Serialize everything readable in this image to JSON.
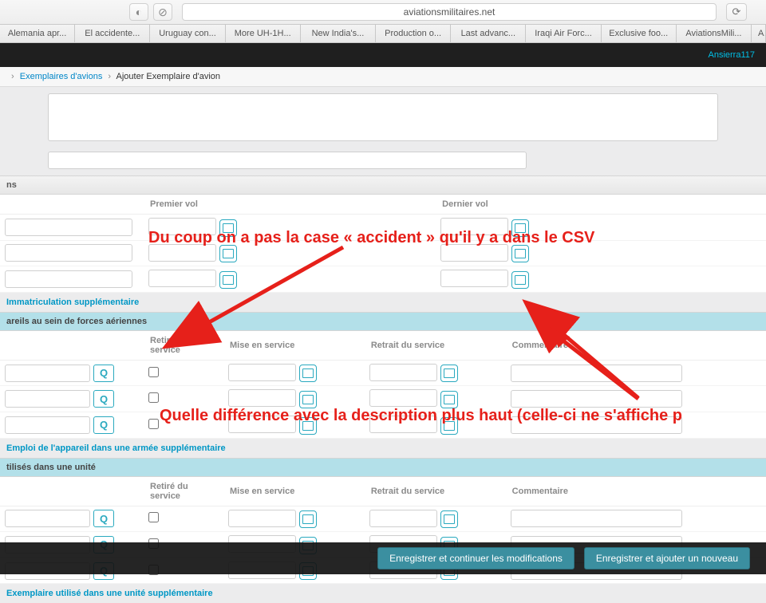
{
  "browser": {
    "address": "aviationsmilitaires.net",
    "tabs": [
      "Alemania apr...",
      "El accidente...",
      "Uruguay con...",
      "More UH-1H...",
      "New India's...",
      "Production o...",
      "Last advanc...",
      "Iraqi Air Forc...",
      "Exclusive foo...",
      "AviationsMili...",
      "A"
    ]
  },
  "topbar": {
    "username": "Ansierra117"
  },
  "breadcrumb": {
    "a": "Exemplaires d'avions",
    "b": "Ajouter Exemplaire d'avion"
  },
  "section": {
    "ns": "ns"
  },
  "headers": {
    "premier_vol": "Premier vol",
    "dernier_vol": "Dernier vol",
    "retire_service": "Retiré du service",
    "mise_service": "Mise en service",
    "retrait_service": "Retrait du service",
    "commentaire": "Commentaire"
  },
  "links": {
    "immat": "Immatriculation supplémentaire",
    "emploi_armee": "Emploi de l'appareil dans une armée supplémentaire",
    "exemplaire_unite": "Exemplaire utilisé dans une unité supplémentaire"
  },
  "sections": {
    "areils_forces": "areils au sein de forces aériennes",
    "utilises_unite": "tilisés dans une unité"
  },
  "buttons": {
    "save_continue": "Enregistrer et continuer les modifications",
    "save_new": "Enregistrer et ajouter un nouveau"
  },
  "annotations": {
    "a1": "Du coup on a pas la case « accident » qu'il y a dans le CSV",
    "a2": "Quelle différence avec la description plus haut (celle-ci ne s'affiche p"
  }
}
